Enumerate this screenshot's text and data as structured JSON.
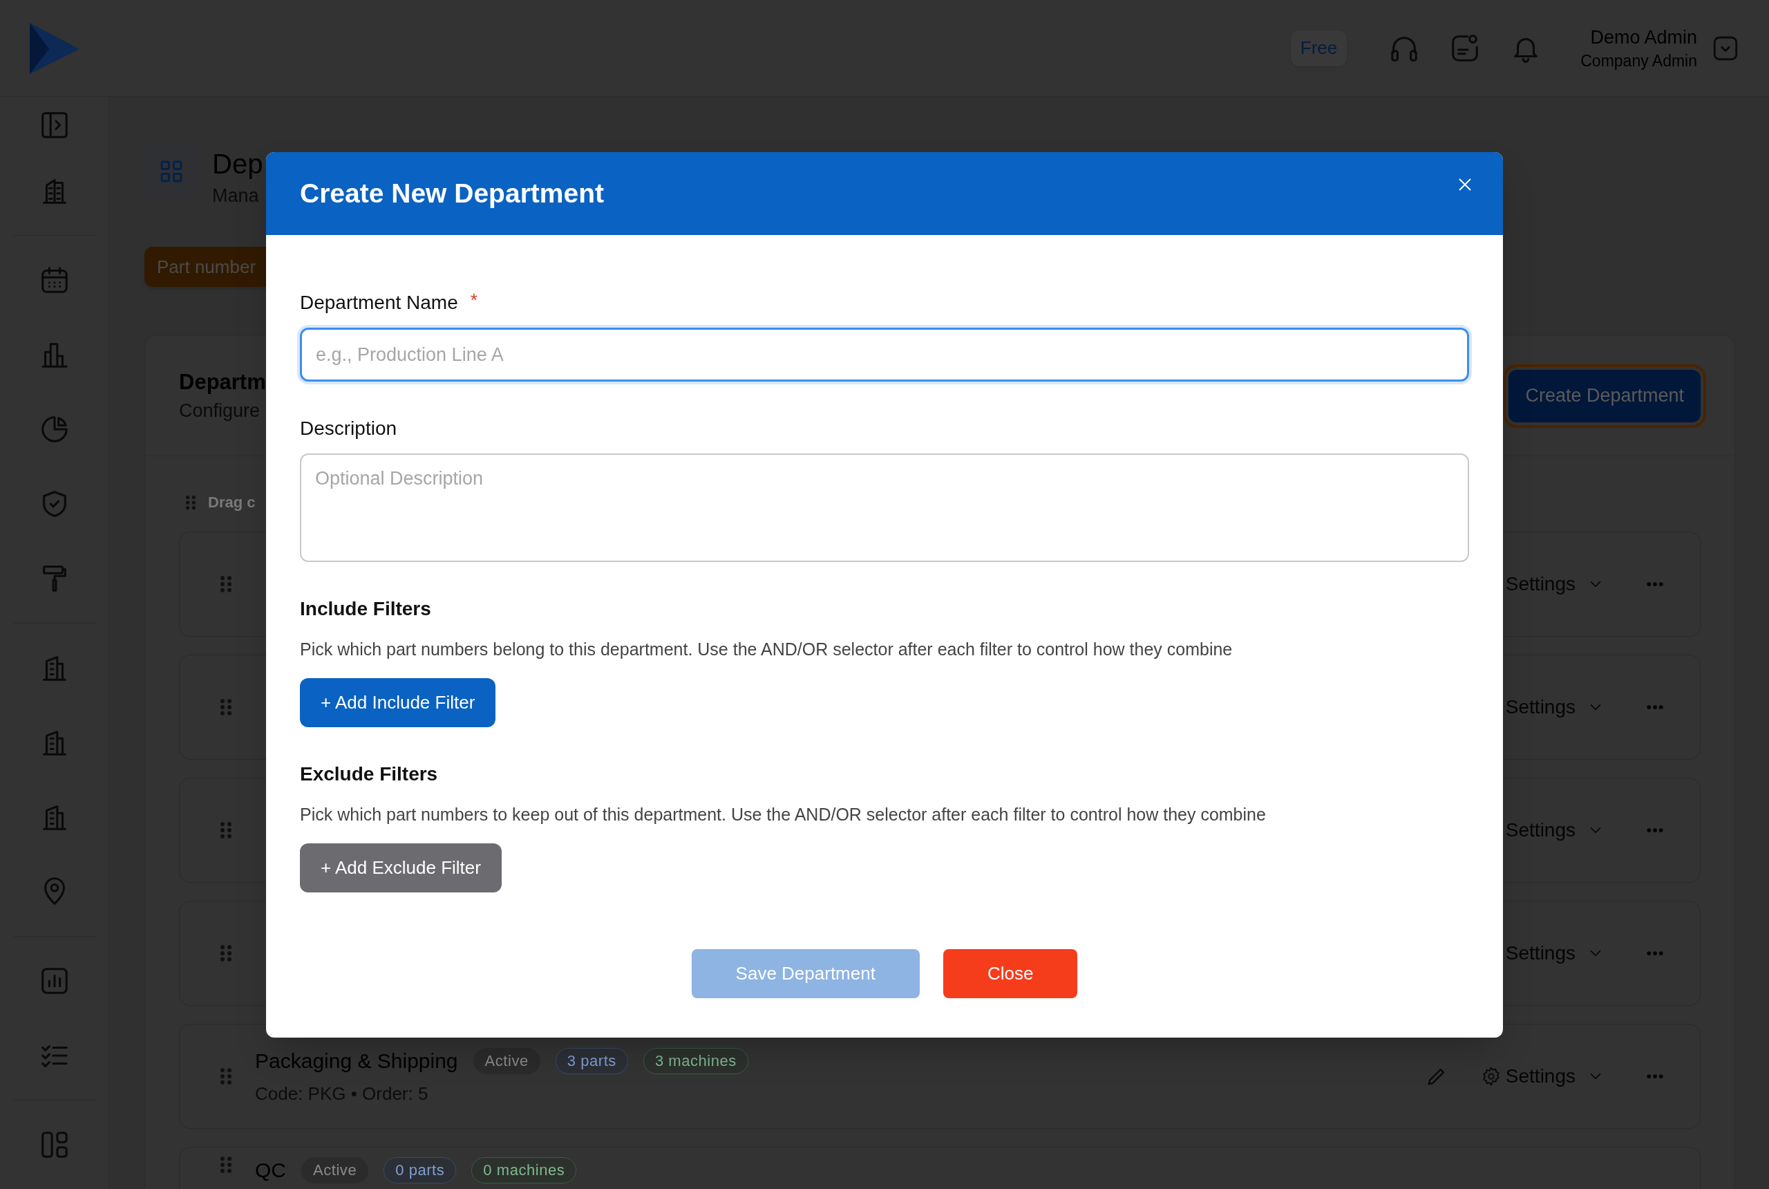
{
  "top_bar": {
    "plan_badge": "Free",
    "user_name": "Demo Admin",
    "user_role": "Company Admin"
  },
  "page": {
    "title": "Dep",
    "subtitle": "Mana",
    "notice": "Part number"
  },
  "departments_card": {
    "title": "Departm",
    "subtitle": "Configure",
    "drag_hint": "Drag c",
    "create_button": "Create Department",
    "rows": [
      {
        "settings": "Settings"
      },
      {
        "settings": "Settings"
      },
      {
        "settings": "Settings"
      },
      {
        "settings": "Settings"
      },
      {
        "name": "Packaging & Shipping",
        "meta": "Code: PKG • Order: 5",
        "settings": "Settings",
        "tags": [
          {
            "text": "Active",
            "kind": "status"
          },
          {
            "text": "3 parts",
            "kind": "parts"
          },
          {
            "text": "3 machines",
            "kind": "machines"
          }
        ]
      },
      {
        "name": "QC",
        "tags": [
          {
            "text": "Active",
            "kind": "status"
          },
          {
            "text": "0 parts",
            "kind": "parts"
          },
          {
            "text": "0 machines",
            "kind": "machines"
          }
        ]
      }
    ]
  },
  "modal": {
    "title": "Create New Department",
    "fields": [
      {
        "kind": "input",
        "label": "Department Name",
        "required_mark": "*",
        "placeholder": "e.g., Production Line A",
        "focused": true
      },
      {
        "kind": "textarea",
        "label": "Description",
        "placeholder": "Optional Description",
        "focused": false
      }
    ],
    "filter_sections": [
      {
        "kind": "include",
        "title": "Include Filters",
        "description": "Pick which part numbers belong to this department. Use the AND/OR selector after each filter to control how they combine",
        "button": "+ Add Include Filter"
      },
      {
        "kind": "exclude",
        "title": "Exclude Filters",
        "description": "Pick which part numbers to keep out of this department. Use the AND/OR selector after each filter to control how they combine",
        "button": "+ Add Exclude Filter"
      }
    ],
    "buttons": [
      {
        "kind": "save",
        "label": "Save Department",
        "disabled": true
      },
      {
        "kind": "close",
        "label": "Close",
        "disabled": false
      }
    ]
  }
}
